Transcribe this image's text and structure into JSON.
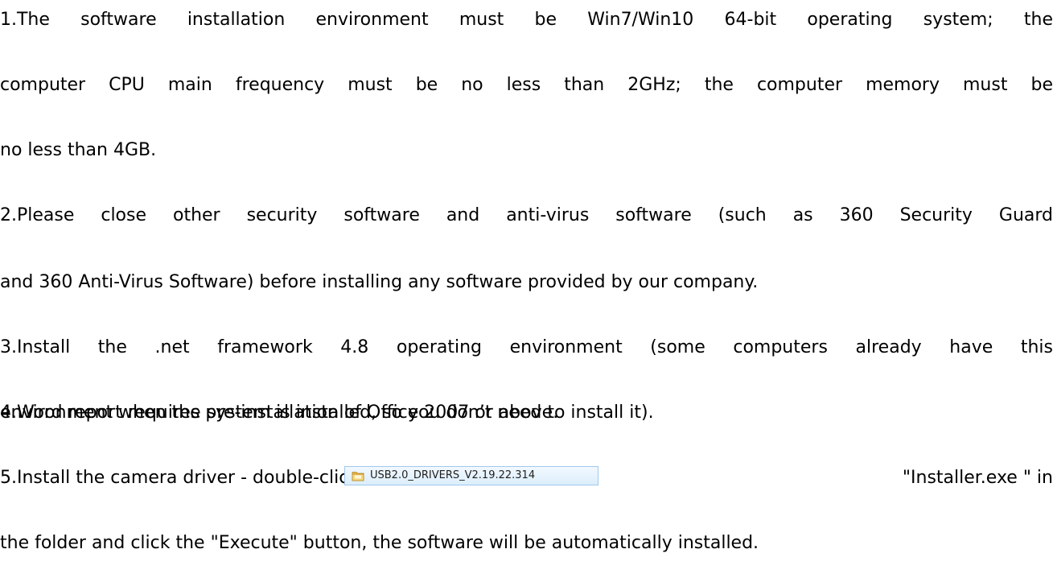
{
  "instructions": {
    "step1": {
      "line1": "1.The software installation environment must be Win7/Win10 64-bit operating system; the",
      "line2": "computer CPU main frequency must be no less than 2GHz; the computer memory must be",
      "line3": "no less than 4GB."
    },
    "step2": {
      "line1": "2.Please close other security software and anti-virus software (such as 360 Security Guard",
      "line2": "and 360 Anti-Virus Software) before installing any software provided by our company."
    },
    "step3": {
      "line1": "3.Install the .net framework 4.8 operating environment (some computers already have this",
      "line2": "environment when the system is installed, so you don’t need to install it)."
    },
    "step4": {
      "line1": "4.Word report requires pre-installation of Office 2007 or above."
    },
    "step5": {
      "prefix": "5.Install the camera driver - double-click",
      "folder_name": "USB2.0_DRIVERS_V2.19.22.314",
      "suffix": "\"Installer.exe \" in",
      "line2": "the folder and click the \"Execute\" button, the software will be automatically installed."
    }
  }
}
